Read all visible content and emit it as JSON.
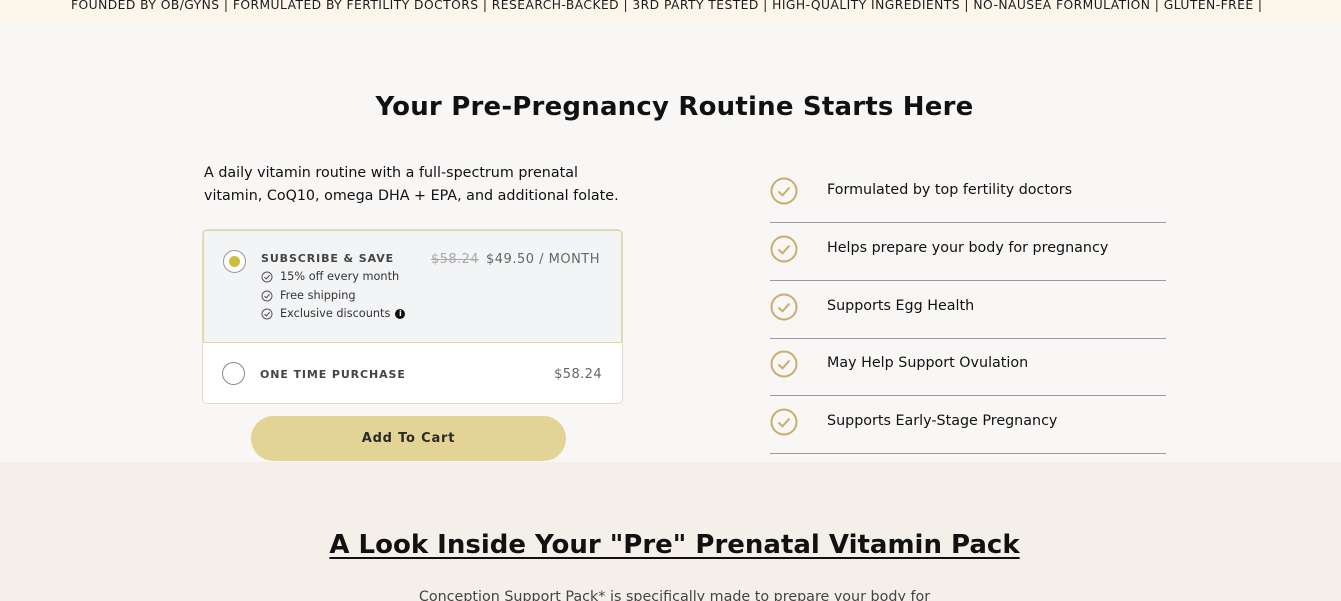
{
  "ticker": {
    "text": "FOUNDED BY OB/GYNS | FORMULATED BY FERTILITY DOCTORS | RESEARCH-BACKED | 3RD PARTY TESTED | HIGH-QUALITY INGREDIENTS | NO-NAUSEA FORMULATION | GLUTEN-FREE |"
  },
  "hero": {
    "title": "Your Pre-Pregnancy Routine Starts Here",
    "description": "A daily vitamin routine with a full-spectrum prenatal vitamin, CoQ10, omega DHA + EPA, and additional folate."
  },
  "purchase": {
    "subscribe": {
      "label": "SUBSCRIBE & SAVE",
      "old_price": "$58.24",
      "price": "$49.50 / MONTH",
      "perks": [
        "15% off every month",
        "Free shipping",
        "Exclusive discounts"
      ],
      "selected": true
    },
    "one_time": {
      "label": "ONE TIME PURCHASE",
      "price": "$58.24",
      "selected": false
    },
    "add_to_cart": "Add To Cart"
  },
  "benefits": [
    "Formulated by top fertility doctors",
    "Helps prepare your body for pregnancy",
    "Supports Egg Health",
    "May Help Support Ovulation",
    "Supports Early-Stage Pregnancy"
  ],
  "lower": {
    "title": "A Look Inside Your \"Pre\" Prenatal Vitamin Pack",
    "subtitle": "Conception Support Pack* is specifically made to prepare your body for"
  },
  "colors": {
    "accent_gold": "#e3d394",
    "check_gold": "#c9ad6e",
    "radio_fill": "#cbbf3c",
    "page_bg": "#f9f7f5",
    "lower_bg": "#f4f0e9"
  },
  "icons": {
    "benefit": "check-circle-icon",
    "perk": "check-circle-small-icon",
    "info": "info-icon"
  }
}
